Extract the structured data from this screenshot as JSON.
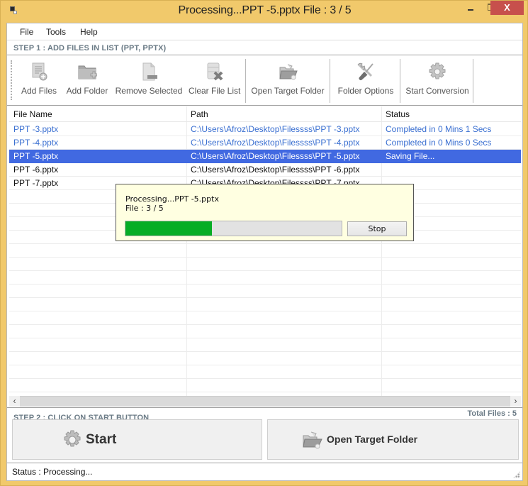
{
  "window": {
    "title": "Processing...PPT -5.pptx File : 3 / 5",
    "controls": {
      "minimize": "–",
      "maximize": "□",
      "close": "X"
    }
  },
  "menu": {
    "items": [
      "File",
      "Tools",
      "Help"
    ]
  },
  "step1": {
    "label": "STEP 1 : ADD FILES IN LIST (PPT, PPTX)"
  },
  "toolbar": {
    "buttons": [
      {
        "label": "Add Files",
        "icon": "add-files-icon"
      },
      {
        "label": "Add Folder",
        "icon": "add-folder-icon"
      },
      {
        "label": "Remove Selected",
        "icon": "remove-selected-icon"
      },
      {
        "label": "Clear File List",
        "icon": "clear-list-icon"
      },
      {
        "label": "Open Target Folder",
        "icon": "open-folder-icon"
      },
      {
        "label": "Folder Options",
        "icon": "tools-icon"
      },
      {
        "label": "Start Conversion",
        "icon": "gear-icon"
      }
    ]
  },
  "table": {
    "columns": [
      "File Name",
      "Path",
      "Status"
    ],
    "rows": [
      {
        "name": "PPT -3.pptx",
        "path": "C:\\Users\\Afroz\\Desktop\\Filessss\\PPT -3.pptx",
        "status": "Completed in 0 Mins 1 Secs",
        "state": "done"
      },
      {
        "name": "PPT -4.pptx",
        "path": "C:\\Users\\Afroz\\Desktop\\Filessss\\PPT -4.pptx",
        "status": "Completed in 0 Mins 0 Secs",
        "state": "done"
      },
      {
        "name": "PPT -5.pptx",
        "path": "C:\\Users\\Afroz\\Desktop\\Filessss\\PPT -5.pptx",
        "status": "Saving File...",
        "state": "sel"
      },
      {
        "name": "PPT -6.pptx",
        "path": "C:\\Users\\Afroz\\Desktop\\Filessss\\PPT -6.pptx",
        "status": "",
        "state": "pending"
      },
      {
        "name": "PPT -7.pptx",
        "path": "C:\\Users\\Afroz\\Desktop\\Filessss\\PPT -7.pptx",
        "status": "",
        "state": "pending"
      }
    ]
  },
  "scroll": {
    "left": "‹",
    "right": "›"
  },
  "step2": {
    "label": "STEP 2 : CLICK ON START BUTTON",
    "total_files": "Total Files : 5"
  },
  "actions": {
    "start_label": "Start",
    "open_label": "Open Target Folder"
  },
  "status": {
    "text": "Status  :  Processing..."
  },
  "popup": {
    "line1": "Processing...PPT -5.pptx",
    "line2": "File : 3 / 5",
    "progress_percent": 40,
    "stop_label": "Stop"
  },
  "colors": {
    "frame": "#f1c96b",
    "close": "#c7504c",
    "selection": "#4169e1",
    "completed_text": "#3a6fd1",
    "progress": "#06ad25",
    "popup_bg": "#ffffe1",
    "step_label": "#6b7b86"
  }
}
